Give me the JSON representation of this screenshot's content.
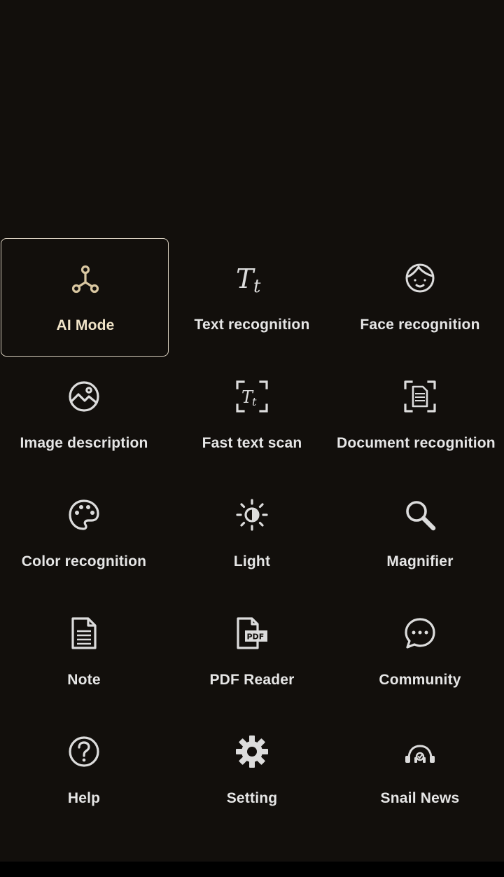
{
  "colors": {
    "background": "#120f0c",
    "icon": "#dcdcdc",
    "selected_accent": "#d9c7a1",
    "selected_border": "#d9d0c0",
    "label": "#e6e6e6"
  },
  "grid": {
    "items": [
      {
        "label": "AI Mode",
        "icon": "ai-mode-icon",
        "selected": true
      },
      {
        "label": "Text recognition",
        "icon": "text-tt-icon"
      },
      {
        "label": "Face recognition",
        "icon": "face-icon"
      },
      {
        "label": "Image description",
        "icon": "image-icon"
      },
      {
        "label": "Fast text scan",
        "icon": "fast-text-scan-icon"
      },
      {
        "label": "Document recognition",
        "icon": "document-scan-icon"
      },
      {
        "label": "Color recognition",
        "icon": "palette-icon"
      },
      {
        "label": "Light",
        "icon": "light-sun-icon"
      },
      {
        "label": "Magnifier",
        "icon": "magnifier-icon"
      },
      {
        "label": "Note",
        "icon": "note-icon"
      },
      {
        "label": "PDF Reader",
        "icon": "pdf-icon"
      },
      {
        "label": "Community",
        "icon": "chat-bubble-icon"
      },
      {
        "label": "Help",
        "icon": "help-icon"
      },
      {
        "label": "Setting",
        "icon": "gear-icon"
      },
      {
        "label": "Snail News",
        "icon": "news-headphones-icon"
      }
    ]
  }
}
